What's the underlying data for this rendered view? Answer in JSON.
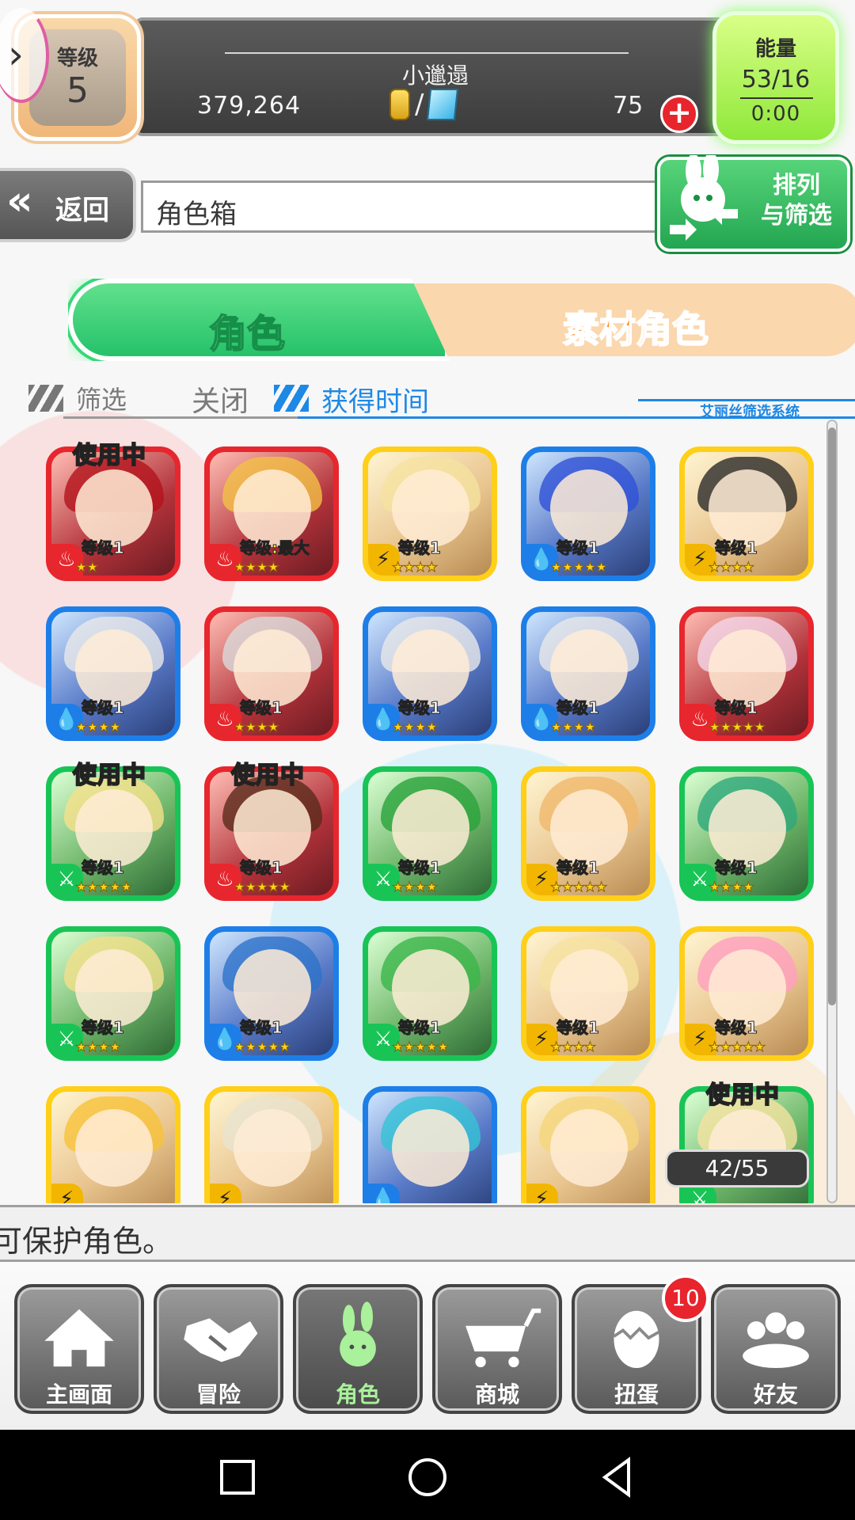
{
  "top": {
    "level_label": "等级",
    "level_value": "5",
    "player_name": "小邋遢",
    "coins": "379,264",
    "currency_slash": "/",
    "gems": "75",
    "energy_label": "能量",
    "energy_value": "53/16",
    "energy_timer": "0:00"
  },
  "nav": {
    "back_label": "返回",
    "title": "角色箱",
    "sort_filter_label": "排列\n与筛选"
  },
  "tabs": [
    {
      "label": "角色",
      "active": true
    },
    {
      "label": "素材角色",
      "active": false
    }
  ],
  "filter": {
    "label": "筛选",
    "state": "关闭",
    "sort_label": "获得时间",
    "system_label": "艾丽丝筛选系统"
  },
  "characters": [
    {
      "element": "fire",
      "level": "等级1",
      "stars": "★★",
      "in_use": "使用中",
      "hair": "#b3131b"
    },
    {
      "element": "fire",
      "level": "等级:最大",
      "stars": "★★★★",
      "in_use": "",
      "hair": "#f2c046"
    },
    {
      "element": "thunder",
      "level": "等级1",
      "stars": "★★★★",
      "in_use": "",
      "hair": "#f5e2a0"
    },
    {
      "element": "water",
      "level": "等级1",
      "stars": "★★★★★",
      "in_use": "",
      "hair": "#2f51d6"
    },
    {
      "element": "thunder",
      "level": "等级1",
      "stars": "★★★★",
      "in_use": "",
      "hair": "#2a2a2a"
    },
    {
      "element": "water",
      "level": "等级1",
      "stars": "★★★★",
      "in_use": "",
      "hair": "#e8e8e8"
    },
    {
      "element": "fire",
      "level": "等级1",
      "stars": "★★★★",
      "in_use": "",
      "hair": "#d9d9d9"
    },
    {
      "element": "water",
      "level": "等级1",
      "stars": "★★★★",
      "in_use": "",
      "hair": "#e8e8e8"
    },
    {
      "element": "water",
      "level": "等级1",
      "stars": "★★★★",
      "in_use": "",
      "hair": "#e8e8e8"
    },
    {
      "element": "fire",
      "level": "等级1",
      "stars": "★★★★★",
      "in_use": "",
      "hair": "#f4d7ea"
    },
    {
      "element": "wood",
      "level": "等级1",
      "stars": "★★★★★",
      "in_use": "使用中",
      "hair": "#f6e18a"
    },
    {
      "element": "fire",
      "level": "等级1",
      "stars": "★★★★★",
      "in_use": "使用中",
      "hair": "#5a2a1a"
    },
    {
      "element": "wood",
      "level": "等级1",
      "stars": "★★★★",
      "in_use": "",
      "hair": "#29a33b"
    },
    {
      "element": "thunder",
      "level": "等级1",
      "stars": "★★★★★",
      "in_use": "",
      "hair": "#f0b86b"
    },
    {
      "element": "wood",
      "level": "等级1",
      "stars": "★★★★",
      "in_use": "",
      "hair": "#2ea77a"
    },
    {
      "element": "wood",
      "level": "等级1",
      "stars": "★★★★",
      "in_use": "",
      "hair": "#f3e08a"
    },
    {
      "element": "water",
      "level": "等级1",
      "stars": "★★★★★",
      "in_use": "",
      "hair": "#2e73c9"
    },
    {
      "element": "wood",
      "level": "等级1",
      "stars": "★★★★★",
      "in_use": "",
      "hair": "#3bb54a"
    },
    {
      "element": "thunder",
      "level": "等级1",
      "stars": "★★★★",
      "in_use": "",
      "hair": "#f5e2a0"
    },
    {
      "element": "thunder",
      "level": "等级1",
      "stars": "★★★★★",
      "in_use": "",
      "hair": "#ff9fc0"
    },
    {
      "element": "thunder",
      "level": "",
      "stars": "",
      "in_use": "",
      "hair": "#f7c23a"
    },
    {
      "element": "thunder",
      "level": "",
      "stars": "",
      "in_use": "",
      "hair": "#e9e4cf"
    },
    {
      "element": "water",
      "level": "",
      "stars": "",
      "in_use": "",
      "hair": "#34c3d6"
    },
    {
      "element": "thunder",
      "level": "",
      "stars": "",
      "in_use": "",
      "hair": "#f5d67a"
    },
    {
      "element": "wood",
      "level": "",
      "stars": "",
      "in_use": "使用中",
      "hair": "#f5e2a0"
    }
  ],
  "element_icons": {
    "fire": "♨",
    "water": "💧",
    "thunder": "⚡",
    "wood": "⚔"
  },
  "box_count": "42/55",
  "hint": "可保护角色。",
  "bottom_nav": [
    {
      "label": "主画面",
      "icon": "home-icon",
      "badge": ""
    },
    {
      "label": "冒险",
      "icon": "handshake-icon",
      "badge": ""
    },
    {
      "label": "角色",
      "icon": "rabbit-icon",
      "badge": "",
      "active": true
    },
    {
      "label": "商城",
      "icon": "cart-icon",
      "badge": ""
    },
    {
      "label": "扭蛋",
      "icon": "egg-icon",
      "badge": "10"
    },
    {
      "label": "好友",
      "icon": "friends-icon",
      "badge": ""
    }
  ],
  "colors": {
    "fire": "#e7262d",
    "water": "#1e7ee8",
    "thunder": "#ffcf1a",
    "wood": "#19c456",
    "accent_blue": "#1e88e5"
  }
}
